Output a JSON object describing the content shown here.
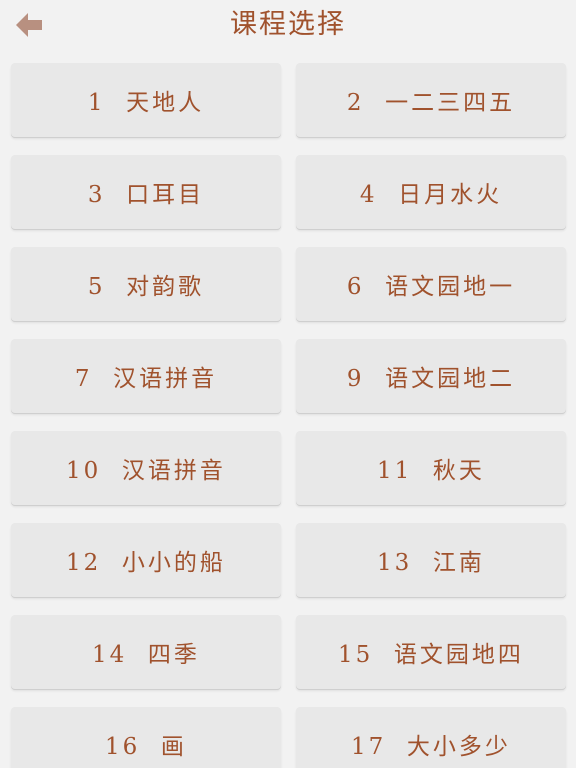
{
  "header": {
    "title": "课程选择",
    "back_icon": "left-arrow-icon",
    "colors": {
      "accent": "#a0522d",
      "icon": "#b89080",
      "background": "#f2f2f2",
      "card": "#e8e8e8"
    }
  },
  "lessons": [
    {
      "number": "1",
      "name": "天地人",
      "label": "1  天地人"
    },
    {
      "number": "2",
      "name": "一二三四五",
      "label": "2  一二三四五"
    },
    {
      "number": "3",
      "name": "口耳目",
      "label": "3  口耳目"
    },
    {
      "number": "4",
      "name": "日月水火",
      "label": "4  日月水火"
    },
    {
      "number": "5",
      "name": "对韵歌",
      "label": "5  对韵歌"
    },
    {
      "number": "6",
      "name": "语文园地一",
      "label": "6  语文园地一"
    },
    {
      "number": "7",
      "name": "汉语拼音",
      "label": "7  汉语拼音"
    },
    {
      "number": "9",
      "name": "语文园地二",
      "label": "9  语文园地二"
    },
    {
      "number": "10",
      "name": "汉语拼音",
      "label": "10  汉语拼音"
    },
    {
      "number": "11",
      "name": "秋天",
      "label": "11  秋天"
    },
    {
      "number": "12",
      "name": "小小的船",
      "label": "12  小小的船"
    },
    {
      "number": "13",
      "name": "江南",
      "label": "13  江南"
    },
    {
      "number": "14",
      "name": "四季",
      "label": "14  四季"
    },
    {
      "number": "15",
      "name": "语文园地四",
      "label": "15  语文园地四"
    },
    {
      "number": "16",
      "name": "画",
      "label": "16  画"
    },
    {
      "number": "17",
      "name": "大小多少",
      "label": "17  大小多少"
    }
  ]
}
